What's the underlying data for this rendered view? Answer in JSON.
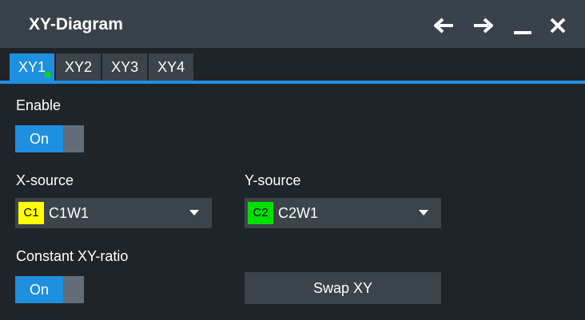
{
  "window": {
    "title": "XY-Diagram",
    "icons": [
      "arrow-left-icon",
      "arrow-right-icon",
      "minimize-icon",
      "close-icon"
    ]
  },
  "tabs": [
    {
      "label": "XY1",
      "active": true,
      "status": "green-dot"
    },
    {
      "label": "XY2",
      "active": false
    },
    {
      "label": "XY3",
      "active": false
    },
    {
      "label": "XY4",
      "active": false
    }
  ],
  "enable": {
    "label": "Enable",
    "state": "On"
  },
  "x_source": {
    "label": "X-source",
    "badge": "C1",
    "badge_color": "#ffff00",
    "value": "C1W1"
  },
  "y_source": {
    "label": "Y-source",
    "badge": "C2",
    "badge_color": "#00e000",
    "value": "C2W1"
  },
  "constant_ratio": {
    "label": "Constant XY-ratio",
    "state": "On"
  },
  "swap_button": {
    "label": "Swap XY"
  },
  "colors": {
    "accent": "#1f8fe0",
    "background": "#1f2429",
    "panel": "#3b434b",
    "titlebar": "#39414a"
  }
}
